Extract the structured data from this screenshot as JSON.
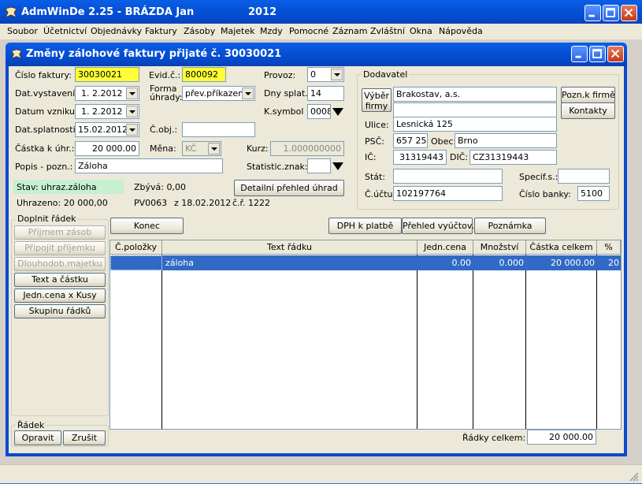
{
  "app": {
    "title": "AdmWinDe 2.25 - BRÁZDA Jan",
    "year": "2012"
  },
  "menu": [
    "Soubor",
    "Účetnictví",
    "Objednávky",
    "Faktury",
    "Zásoby",
    "Majetek",
    "Mzdy",
    "Pomocné",
    "Záznam",
    "Zvláštní",
    "Okna",
    "Nápověda"
  ],
  "dialog": {
    "title": "Změny zálohové faktury přijaté č. 30030021"
  },
  "form": {
    "cislo_faktury_label": "Číslo faktury:",
    "cislo_faktury": "30030021",
    "evid_label": "Evid.č.:",
    "evid": "800092",
    "provoz_label": "Provoz:",
    "provoz": "0",
    "dat_vystaveni_label": "Dat.vystavení:",
    "dat_vystaveni": "1. 2.2012",
    "forma_uhrady_label1": "Forma",
    "forma_uhrady_label2": "úhrady:",
    "forma_uhrady": "přev.příkazem",
    "dny_splat_label": "Dny splat.:",
    "dny_splat": "14",
    "datum_vzniku_label": "Datum vzniku:",
    "datum_vzniku": "1. 2.2012",
    "ksymbol_label": "K.symbol :",
    "ksymbol": "0008",
    "dat_splatnosti_label": "Dat.splatnosti:",
    "dat_splatnosti": "15.02.2012",
    "cobj_label": "Č.obj.:",
    "cobj": "",
    "castka_label": "Částka k úhr.:",
    "castka": "20 000.00",
    "mena_label": "Měna:",
    "mena": "KČ",
    "kurz_label": "Kurz:",
    "kurz": "1.000000000",
    "popis_label": "Popis - pozn.:",
    "popis": "Záloha",
    "statistic_label": "Statistic.znak:",
    "statistic": ""
  },
  "status": {
    "stav": "Stav: uhraz.záloha",
    "zbyva": "Zbývá: 0,00",
    "detail_button": "Detailní přehled úhrad",
    "uhrazeno": "Uhrazeno: 20 000,00",
    "pv": "PV0063",
    "z_date": "z 18.02.2012",
    "cr": "č.ř. 1222"
  },
  "dodavatel": {
    "group_label": "Dodavatel",
    "vyber_button_l1": "Výběr",
    "vyber_button_l2": "firmy",
    "name": "Brakostav, a.s.",
    "name2": "",
    "pozn_button": "Pozn.k firmě",
    "kontakty_button": "Kontakty",
    "ulice_label": "Ulice:",
    "ulice": "Lesnická 125",
    "psc_label": "PSČ:",
    "psc": "657 25",
    "obec_label": "Obec:",
    "obec": "Brno",
    "ic_label": "IČ:",
    "ic": "31319443",
    "dic_label": "DIČ:",
    "dic": "CZ31319443",
    "stat_label": "Stát:",
    "stat": "",
    "specif_label": "Specif.s.:",
    "specif": "",
    "cuctu_label": "Č.účtu:",
    "cuctu": "102197764",
    "cislo_banky_label": "Číslo banky:",
    "cislo_banky": "5100"
  },
  "doplnit": {
    "group_label": "Doplnit řádek",
    "buttons": [
      "Příjmem zásob",
      "Připojit příjemku",
      "Dlouhodob.majetku",
      "Text a částku",
      "Jedn.cena x Kusy",
      "Skupinu řádků"
    ]
  },
  "actions": {
    "konec": "Konec",
    "dph": "DPH k platbě",
    "prehled": "Přehled vyúčtov.",
    "poznamka": "Poznámka"
  },
  "table": {
    "columns": [
      "Č.položky",
      "Text řádku",
      "Jedn.cena",
      "Množství",
      "Částka celkem",
      "%"
    ],
    "rows": [
      {
        "polozka": "",
        "text": "záloha",
        "jedn_cena": "0.00",
        "mnozstvi": "0.000",
        "castka": "20 000.00",
        "pct": "20"
      }
    ]
  },
  "radek": {
    "group_label": "Řádek",
    "opravit": "Opravit",
    "zrusit": "Zrušit"
  },
  "totals": {
    "label": "Řádky celkem:",
    "value": "20 000.00"
  },
  "colors": {
    "selection": "#316ac5",
    "highlight_yellow": "#ffff33",
    "status_green": "#c6f0cf"
  }
}
